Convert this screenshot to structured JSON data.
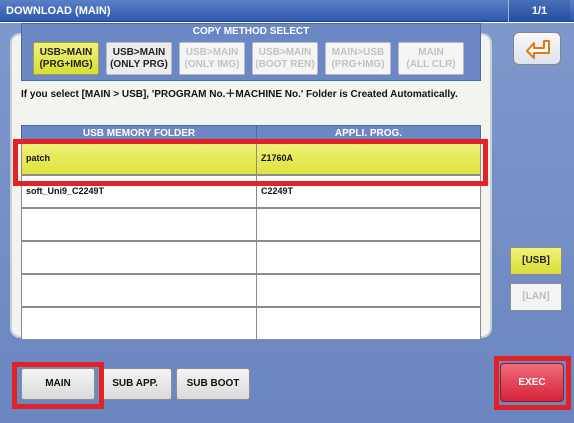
{
  "titlebar": {
    "title": "DOWNLOAD (MAIN)",
    "page": "1/1"
  },
  "copy_method": {
    "header": "COPY METHOD SELECT",
    "options": [
      {
        "label": "USB>MAIN\n(PRG+IMG)",
        "state": "selected"
      },
      {
        "label": "USB>MAIN\n(ONLY PRG)",
        "state": "enabled"
      },
      {
        "label": "USB>MAIN\n(ONLY IMG)",
        "state": "disabled"
      },
      {
        "label": "USB>MAIN\n(BOOT REN)",
        "state": "disabled"
      },
      {
        "label": "MAIN>USB\n(PRG+IMG)",
        "state": "disabled"
      },
      {
        "label": "MAIN\n(ALL CLR)",
        "state": "disabled"
      }
    ]
  },
  "notice": "If you select [MAIN > USB], 'PROGRAM No.＋MACHINE No.' Folder is Created Automatically.",
  "folder_table": {
    "columns": [
      "USB MEMORY FOLDER",
      "APPLI. PROG."
    ],
    "rows": [
      [
        "patch",
        "Z1760A"
      ],
      [
        "soft_Uni9_C2249T",
        "C2249T"
      ],
      [
        "",
        ""
      ],
      [
        "",
        ""
      ],
      [
        "",
        ""
      ],
      [
        "",
        ""
      ]
    ],
    "selected_row": 0
  },
  "tabs": {
    "main": "MAIN",
    "sub_app": "SUB APP.",
    "sub_boot": "SUB BOOT"
  },
  "right_panel": {
    "usb": "[USB]",
    "lan": "[LAN]",
    "exec": "EXEC",
    "back_icon": "return-arrow-icon"
  },
  "colors": {
    "accent_blue": "#6b87c4",
    "selected_yellow": "#e4e53a",
    "exec_red": "#d6223a",
    "highlight_red": "#e12226"
  }
}
